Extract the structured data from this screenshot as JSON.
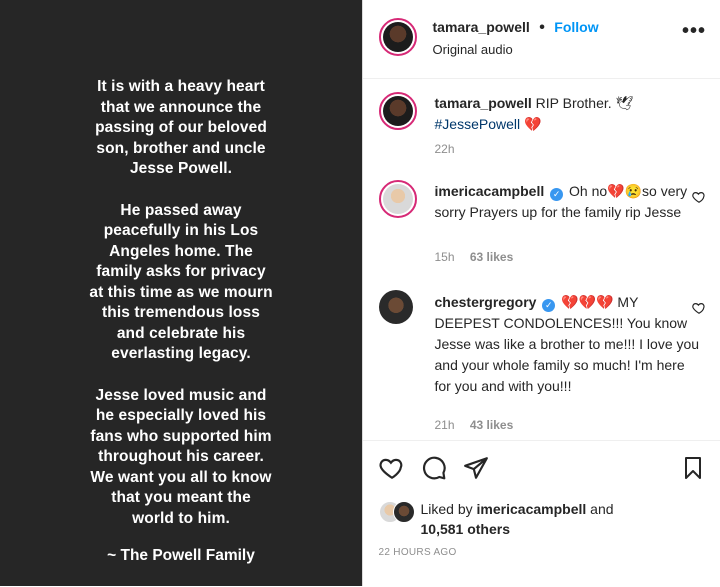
{
  "story": {
    "paragraphs": [
      "It is with a heavy heart\nthat we announce the\npassing of our beloved\nson, brother and uncle\nJesse Powell.",
      "He passed away\npeacefully in his Los\nAngeles home. The\nfamily asks for privacy\nat this time as we mourn\nthis tremendous loss\nand celebrate his\neverlasting legacy.",
      "Jesse loved music and\nhe especially loved his\nfans who supported him\nthroughout his career.\nWe want you all to know\nthat you meant the\nworld to him."
    ],
    "signoff": "~ The Powell Family"
  },
  "header": {
    "username": "tamara_powell",
    "separator": "•",
    "follow_label": "Follow",
    "audio": "Original audio",
    "more": "•••"
  },
  "caption": {
    "username": "tamara_powell",
    "text": "RIP Brother. 🕊",
    "hashtag": "#JessePowell",
    "emoji": "💔",
    "time": "22h"
  },
  "comments": [
    {
      "username": "imericacampbell",
      "verified": "✓",
      "text": "Oh no💔😢so very sorry Prayers up for the family rip Jesse",
      "time": "15h",
      "likes": "63 likes"
    },
    {
      "username": "chestergregory",
      "verified": "✓",
      "text": "💔💔💔 MY DEEPEST CONDOLENCES!!! You know Jesse was like a brother to me!!! I love you and your whole family so much! I'm here for you and with you!!!",
      "time": "21h",
      "likes": "43 likes"
    }
  ],
  "likes": {
    "prefix": "Liked by",
    "user": "imericacampbell",
    "and": "and",
    "others": "10,581 others"
  },
  "posted": "22 HOURS AGO",
  "colors": {
    "accent": "#0095f6",
    "ring": "#d62976",
    "story_bg": "#262626",
    "heart": "#e0245e"
  }
}
